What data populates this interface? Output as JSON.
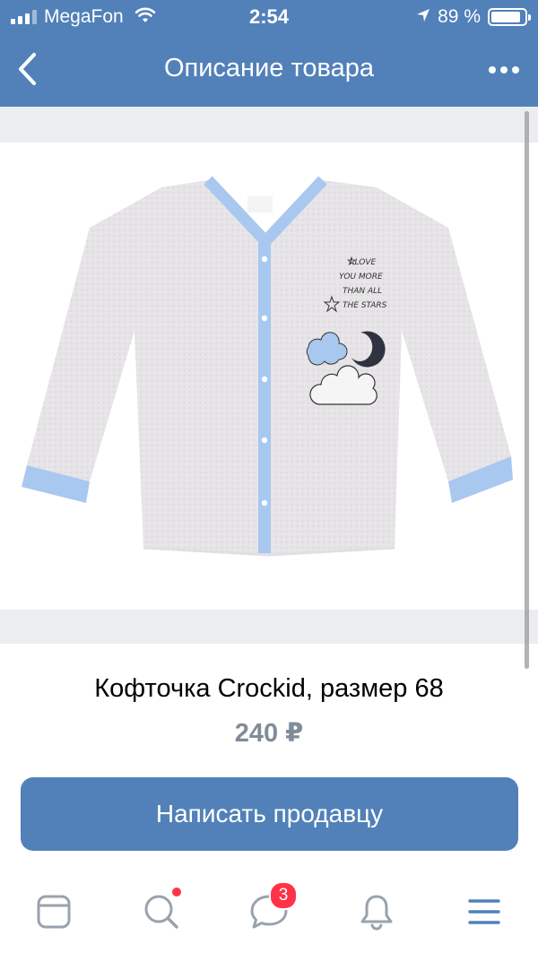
{
  "status_bar": {
    "carrier": "MegaFon",
    "time": "2:54",
    "battery_percent": "89 %",
    "battery_level": 0.89
  },
  "nav": {
    "title": "Описание товара"
  },
  "product": {
    "name": "Кофточка Crockid, размер 68",
    "price": "240 ₽",
    "image": {
      "print_text": [
        "I LOVE",
        "YOU MORE",
        "THAN ALL",
        "THE STARS"
      ],
      "body_color": "#e6e4e6",
      "trim_color": "#a9c8f0"
    }
  },
  "actions": {
    "contact_label": "Написать продавцу"
  },
  "tabbar": {
    "items": [
      {
        "name": "news",
        "icon": "news-feed-icon"
      },
      {
        "name": "search",
        "icon": "search-icon",
        "has_dot": true
      },
      {
        "name": "messages",
        "icon": "messages-icon",
        "badge": "3"
      },
      {
        "name": "notifications",
        "icon": "bell-icon"
      },
      {
        "name": "menu",
        "icon": "menu-icon"
      }
    ]
  },
  "colors": {
    "brand": "#5181b8",
    "price_gray": "#818c99",
    "badge_red": "#ff3347",
    "band_gray": "#ebedf0"
  }
}
